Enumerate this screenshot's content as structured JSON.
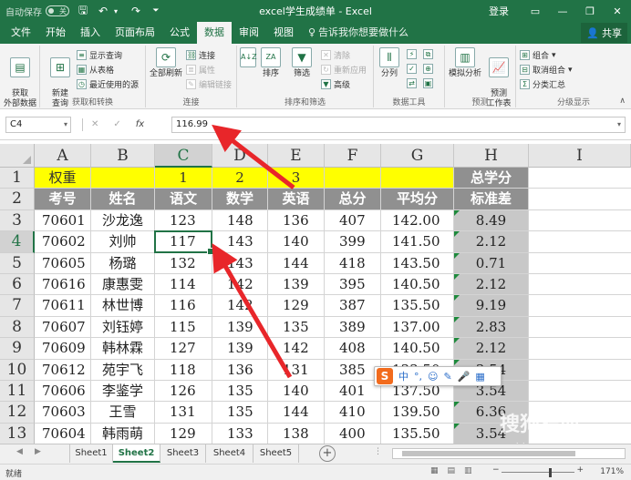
{
  "titlebar": {
    "autosave": "自动保存",
    "autosave_state": "关",
    "doc_title": "excel学生成绩单 - Excel",
    "login": "登录"
  },
  "tabs": {
    "items": [
      "文件",
      "开始",
      "插入",
      "页面布局",
      "公式",
      "数据",
      "审阅",
      "视图"
    ],
    "active": "数据",
    "search": "告诉我你想要做什么",
    "share": "共享"
  },
  "ribbon": {
    "get_external": "获取\n外部数据",
    "new_query": "新建\n查询",
    "show_queries": "显示查询",
    "from_table": "从表格",
    "recent_sources": "最近使用的源",
    "group_get_transform": "获取和转换",
    "refresh_all": "全部刷新",
    "connections": "连接",
    "properties": "属性",
    "edit_links": "编辑链接",
    "group_connections": "连接",
    "sort": "排序",
    "filter": "筛选",
    "clear": "清除",
    "reapply": "重新应用",
    "advanced": "高级",
    "group_sort_filter": "排序和筛选",
    "text_to_columns": "分列",
    "group_data_tools": "数据工具",
    "what_if": "模拟分析",
    "forecast_sheet": "预测\n工作表",
    "group_forecast": "预测",
    "group": "组合",
    "ungroup": "取消组合",
    "subtotal": "分类汇总",
    "group_outline": "分级显示"
  },
  "formula_bar": {
    "name_box": "C4",
    "formula": "116.99"
  },
  "columns": [
    "A",
    "B",
    "C",
    "D",
    "E",
    "F",
    "G",
    "H",
    "I"
  ],
  "rows": [
    "1",
    "2",
    "3",
    "4",
    "5",
    "6",
    "7",
    "8",
    "9",
    "10",
    "11",
    "12",
    "13"
  ],
  "selected_cell": "C4",
  "table": {
    "row1": [
      "权重",
      "",
      "1",
      "2",
      "3",
      "",
      "",
      "总学分"
    ],
    "row2": [
      "考号",
      "姓名",
      "语文",
      "数学",
      "英语",
      "总分",
      "平均分",
      "标准差"
    ],
    "data": [
      [
        "70601",
        "沙龙逸",
        "123",
        "148",
        "136",
        "407",
        "142.00",
        "8.49"
      ],
      [
        "70602",
        "刘帅",
        "117",
        "143",
        "140",
        "399",
        "141.50",
        "2.12"
      ],
      [
        "70605",
        "杨璐",
        "132",
        "143",
        "144",
        "418",
        "143.50",
        "0.71"
      ],
      [
        "70616",
        "康惠雯",
        "114",
        "142",
        "139",
        "395",
        "140.50",
        "2.12"
      ],
      [
        "70611",
        "林世博",
        "116",
        "142",
        "129",
        "387",
        "135.50",
        "9.19"
      ],
      [
        "70607",
        "刘钰婷",
        "115",
        "139",
        "135",
        "389",
        "137.00",
        "2.83"
      ],
      [
        "70609",
        "韩林霖",
        "127",
        "139",
        "142",
        "408",
        "140.50",
        "2.12"
      ],
      [
        "70612",
        "苑宇飞",
        "118",
        "136",
        "131",
        "385",
        "133.50",
        "3.54"
      ],
      [
        "70606",
        "李鉴学",
        "126",
        "135",
        "140",
        "401",
        "137.50",
        "3.54"
      ],
      [
        "70603",
        "王雪",
        "131",
        "135",
        "144",
        "410",
        "139.50",
        "6.36"
      ],
      [
        "70604",
        "韩雨萌",
        "129",
        "133",
        "138",
        "400",
        "135.50",
        "3.54"
      ]
    ]
  },
  "sheets": {
    "tabs": [
      "Sheet1",
      "Sheet2",
      "Sheet3",
      "Sheet4",
      "Sheet5"
    ],
    "active": "Sheet2"
  },
  "ime": {
    "logo": "S",
    "mode": "中"
  },
  "watermark": {
    "text": "搜狗指南",
    "url": "zhinan.sogou.com"
  },
  "status": {
    "ready": "就绪",
    "zoom": "171%"
  },
  "colors": {
    "excel_green": "#217346",
    "weight_row": "#ffff00",
    "header_row": "#909090",
    "arrow": "#e8262a"
  }
}
